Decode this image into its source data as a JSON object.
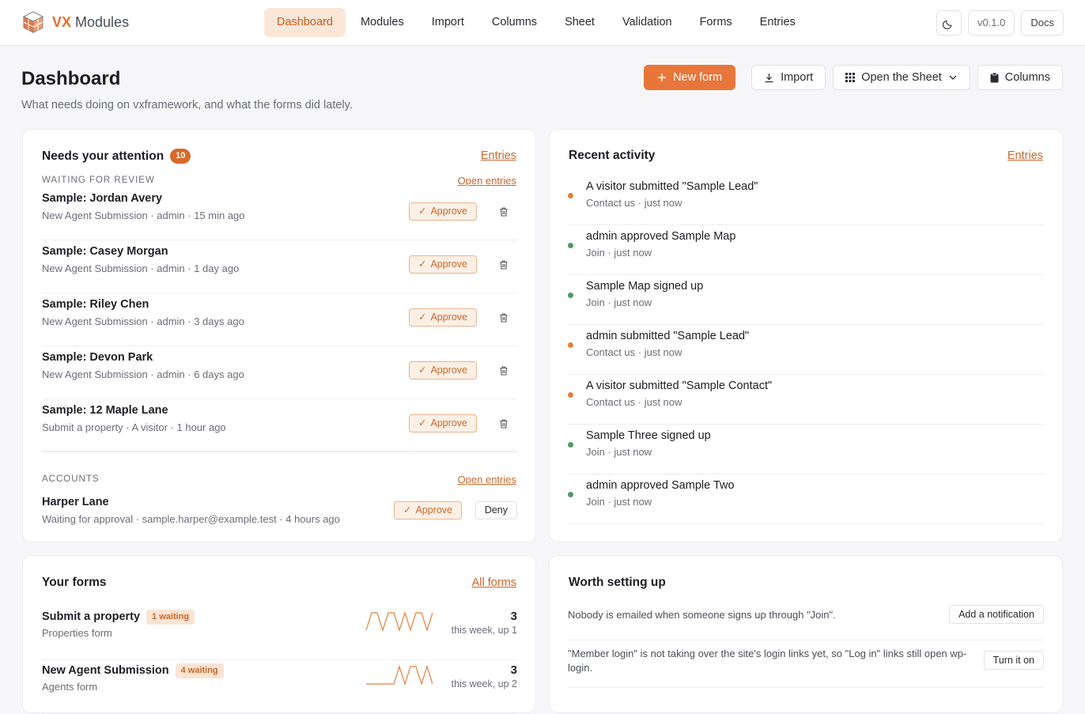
{
  "brand": {
    "vx": "VX",
    "name": "Modules"
  },
  "nav": [
    "Dashboard",
    "Modules",
    "Import",
    "Columns",
    "Sheet",
    "Validation",
    "Forms",
    "Entries"
  ],
  "topbar": {
    "version": "v0.1.0",
    "docs": "Docs",
    "theme_icon": "moon-icon"
  },
  "header": {
    "title": "Dashboard",
    "subtitle": "What needs doing on vxframework, and what the forms did lately.",
    "new_form": "New form",
    "import": "Import",
    "open_sheet": "Open the Sheet",
    "columns": "Columns"
  },
  "attention": {
    "title": "Needs your attention",
    "count": "10",
    "link": "Entries",
    "review_label": "WAITING FOR REVIEW",
    "review_link": "Open entries",
    "approve": "Approve",
    "items": [
      {
        "title": "Sample: Jordan Avery",
        "meta": "New Agent Submission · admin · 15 min ago"
      },
      {
        "title": "Sample: Casey Morgan",
        "meta": "New Agent Submission · admin · 1 day ago"
      },
      {
        "title": "Sample: Riley Chen",
        "meta": "New Agent Submission · admin · 3 days ago"
      },
      {
        "title": "Sample: Devon Park",
        "meta": "New Agent Submission · admin · 6 days ago"
      },
      {
        "title": "Sample: 12 Maple Lane",
        "meta": "Submit a property · A visitor · 1 hour ago"
      }
    ],
    "accounts_label": "ACCOUNTS",
    "accounts_link": "Open entries",
    "account": {
      "name": "Harper Lane",
      "meta": "Waiting for approval · sample.harper@example.test · 4 hours ago",
      "approve": "Approve",
      "deny": "Deny"
    }
  },
  "activity": {
    "title": "Recent activity",
    "link": "Entries",
    "colors": {
      "submitted": "#e0803d",
      "approved": "#4d9a64"
    },
    "items": [
      {
        "title": "A visitor submitted \"Sample Lead\"",
        "meta": "Contact us · just now",
        "kind": "submitted"
      },
      {
        "title": "admin approved Sample Map",
        "meta": "Join · just now",
        "kind": "approved"
      },
      {
        "title": "Sample Map signed up",
        "meta": "Join · just now",
        "kind": "approved"
      },
      {
        "title": "admin submitted \"Sample Lead\"",
        "meta": "Contact us · just now",
        "kind": "submitted"
      },
      {
        "title": "A visitor submitted \"Sample Contact\"",
        "meta": "Contact us · just now",
        "kind": "submitted"
      },
      {
        "title": "Sample Three signed up",
        "meta": "Join · just now",
        "kind": "approved"
      },
      {
        "title": "admin approved Sample Two",
        "meta": "Join · just now",
        "kind": "approved"
      }
    ]
  },
  "forms": {
    "title": "Your forms",
    "link": "All forms",
    "items": [
      {
        "title": "Submit a property",
        "waiting": "1 waiting",
        "sub": "Properties form",
        "count": "3",
        "trend": "this week, up 1",
        "spark": [
          0,
          2,
          2,
          0,
          2,
          2,
          0,
          2,
          0,
          2,
          2,
          0,
          2
        ]
      },
      {
        "title": "New Agent Submission",
        "waiting": "4 waiting",
        "sub": "Agents form",
        "count": "3",
        "trend": "this week, up 2",
        "spark": [
          0,
          0,
          0,
          0,
          0,
          0,
          2,
          0,
          2,
          2,
          0,
          2,
          0
        ]
      }
    ]
  },
  "setup": {
    "title": "Worth setting up",
    "items": [
      {
        "text": "Nobody is emailed when someone signs up through \"Join\".",
        "action": "Add a notification"
      },
      {
        "text": "\"Member login\" is not taking over the site's login links yet, so \"Log in\" links still open wp-login.",
        "action": "Turn it on"
      }
    ]
  }
}
